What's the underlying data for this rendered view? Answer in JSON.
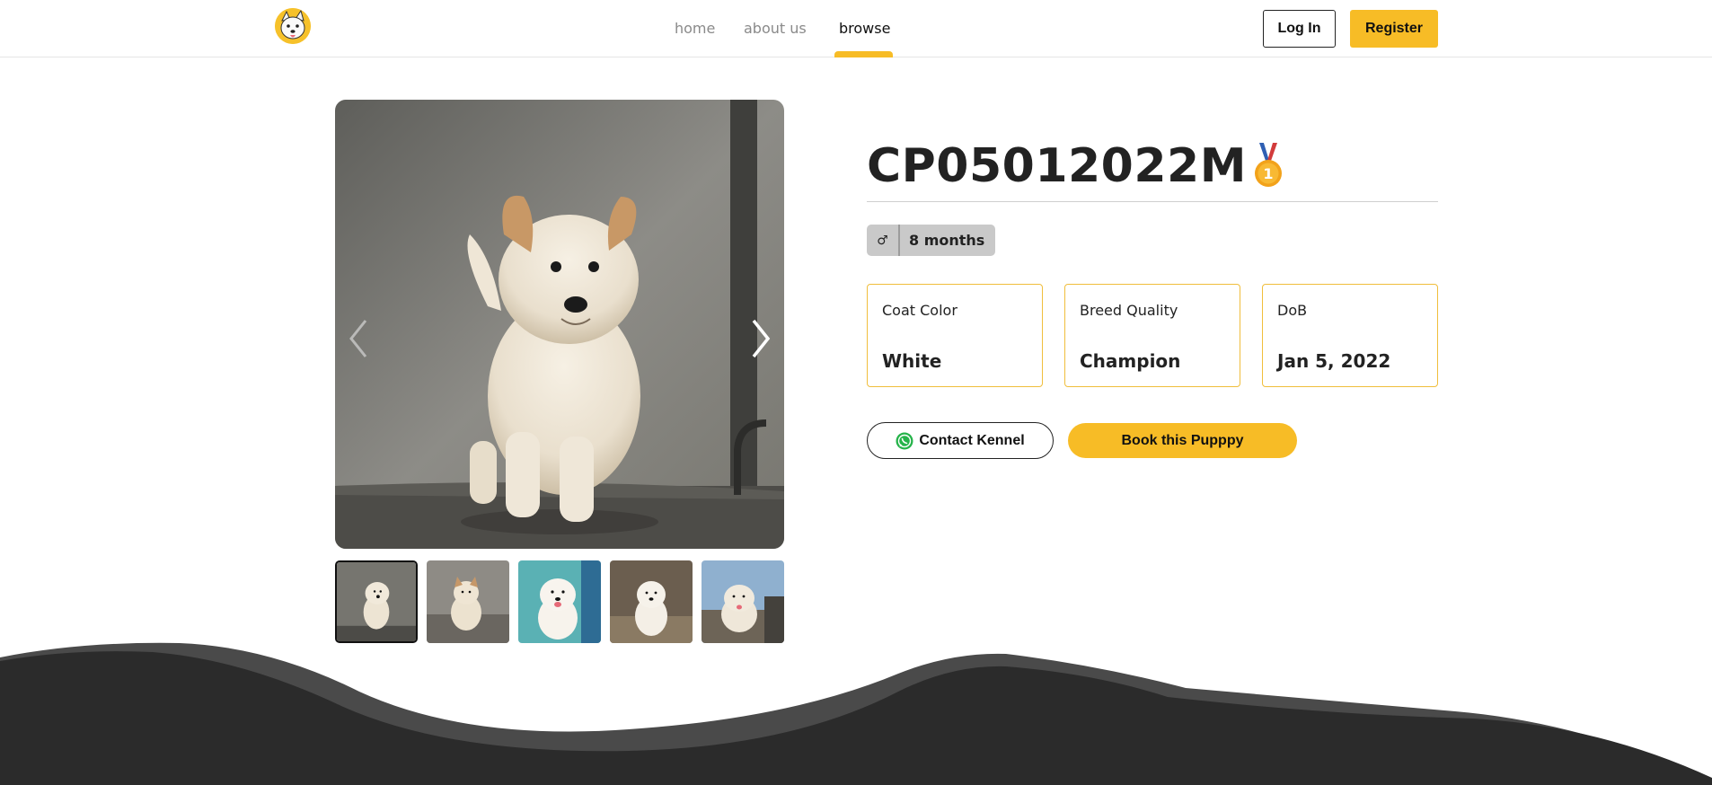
{
  "header": {
    "logo": "puppy-logo-icon",
    "nav": [
      {
        "label": "home",
        "active": false
      },
      {
        "label": "about us",
        "active": false
      },
      {
        "label": "browse",
        "active": true
      }
    ],
    "login_label": "Log In",
    "register_label": "Register"
  },
  "gallery": {
    "thumbnail_count": 5,
    "selected_index": 0,
    "prev_icon": "chevron-left-icon",
    "next_icon": "chevron-right-icon"
  },
  "puppy": {
    "name": "CP05012022M",
    "badge": "first-place-medal-icon",
    "gender_symbol": "♂",
    "age": "8 months",
    "specs": [
      {
        "label": "Coat Color",
        "value": "White"
      },
      {
        "label": "Breed Quality",
        "value": "Champion"
      },
      {
        "label": "DoB",
        "value": "Jan 5, 2022"
      }
    ],
    "contact_label": "Contact Kennel",
    "book_label": "Book this Pupppy"
  },
  "colors": {
    "accent": "#f7bc26",
    "dark": "#2b2b2b",
    "wave_mid": "#4a4a4a",
    "tag_bg": "#c9c9c9"
  }
}
